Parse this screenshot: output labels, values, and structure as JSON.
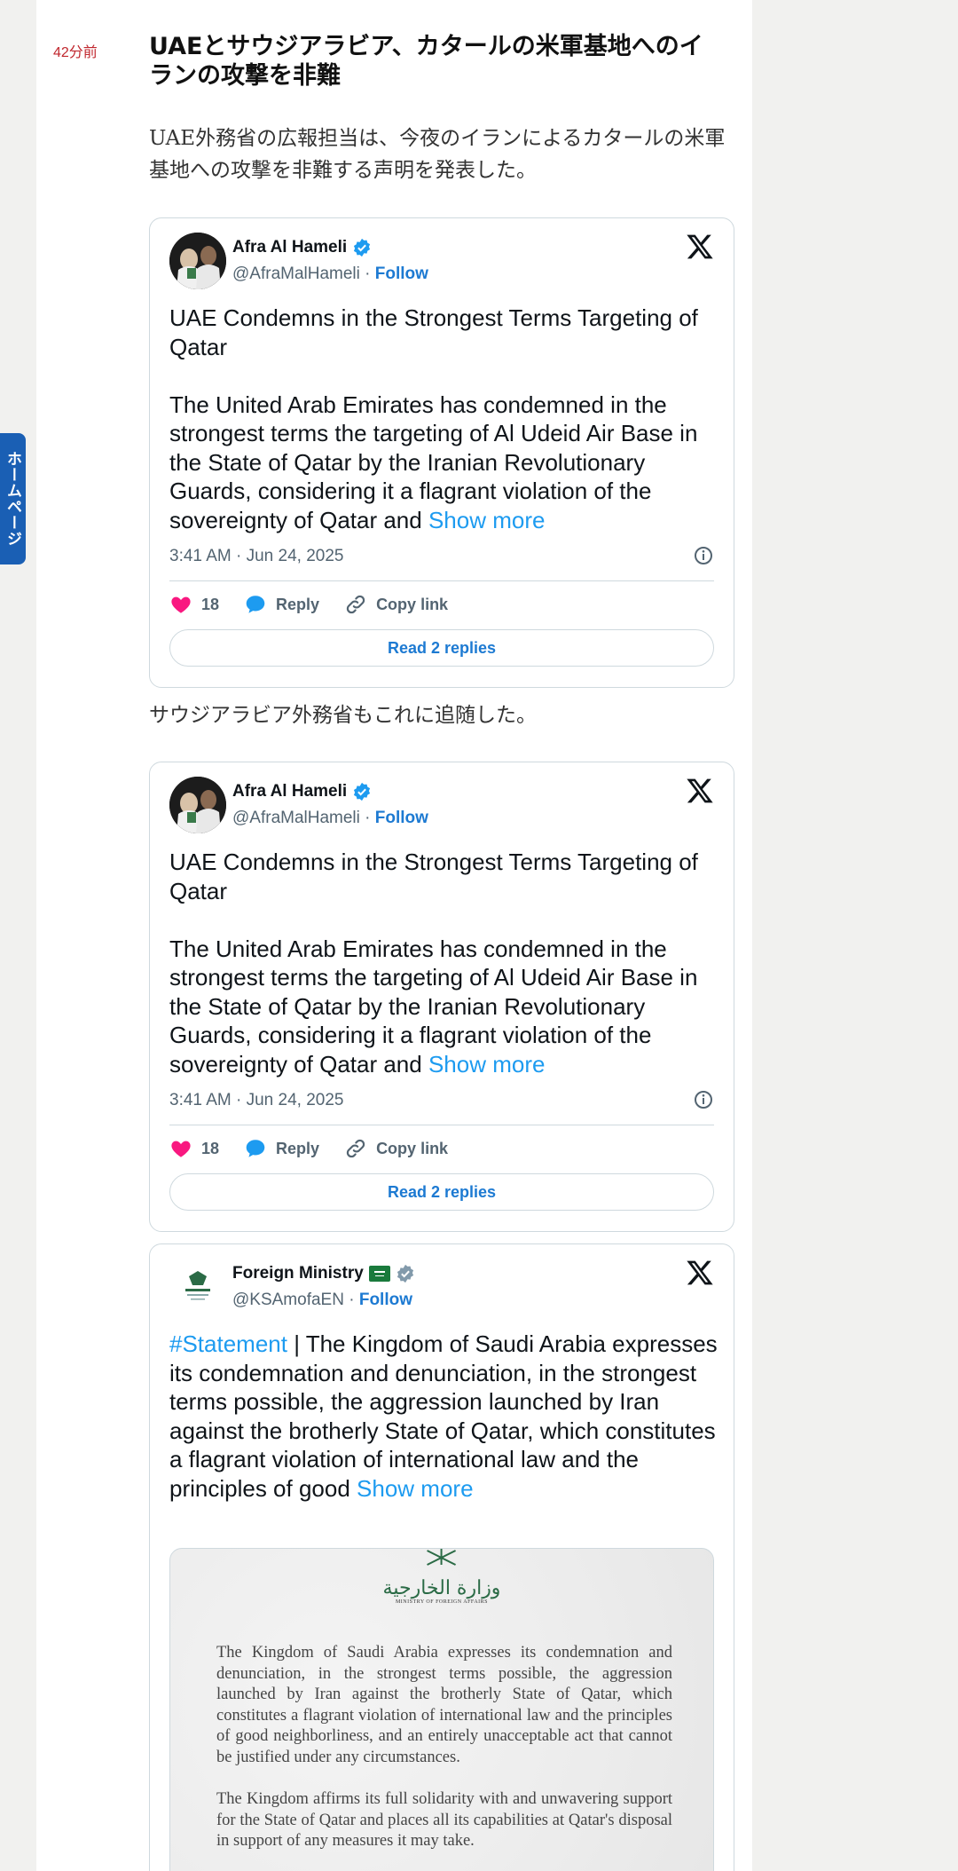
{
  "side_tab": {
    "label": "ホームページ"
  },
  "article": {
    "time_ago": "42分前",
    "headline": "UAEとサウジアラビア、カタールの米軍基地へのイランの攻撃を非難",
    "para1": "UAE外務省の広報担当は、今夜のイランによるカタールの米軍基地への攻撃を非難する声明を発表した。",
    "para2": "サウジアラビア外務省もこれに追随した。"
  },
  "tweets": [
    {
      "name": "Afra Al Hameli",
      "handle": "@AfraMalHameli",
      "follow": "Follow",
      "sep": " · ",
      "text": "UAE Condemns in the Strongest Terms Targeting of Qatar\n\nThe United Arab Emirates has condemned in the strongest terms the targeting of Al Udeid Air Base in the State of Qatar by the Iranian Revolutionary Guards, considering it a flagrant violation of the sovereignty of Qatar and",
      "show_more": "Show more",
      "date": "3:41 AM · Jun 24, 2025",
      "likes": "18",
      "reply": "Reply",
      "copy": "Copy link",
      "read_replies": "Read 2 replies"
    },
    {
      "name": "Afra Al Hameli",
      "handle": "@AfraMalHameli",
      "follow": "Follow",
      "sep": " · ",
      "text": "UAE Condemns in the Strongest Terms Targeting of Qatar\n\nThe United Arab Emirates has condemned in the strongest terms the targeting of Al Udeid Air Base in the State of Qatar by the Iranian Revolutionary Guards, considering it a flagrant violation of the sovereignty of Qatar and",
      "show_more": "Show more",
      "date": "3:41 AM · Jun 24, 2025",
      "likes": "18",
      "reply": "Reply",
      "copy": "Copy link",
      "read_replies": "Read 2 replies"
    },
    {
      "name": "Foreign Ministry",
      "handle": "@KSAmofaEN",
      "follow": "Follow",
      "sep": " · ",
      "hashtag": "#Statement",
      "text": " | The Kingdom of Saudi Arabia expresses its condemnation and denunciation, in the strongest terms possible, the aggression launched by Iran against the brotherly State of Qatar, which constitutes a flagrant violation of international law and the principles of good",
      "show_more": "Show more",
      "image": {
        "emblem_ar": "وزارة الخارجية",
        "emblem_en": "MINISTRY OF FOREIGN AFFAIRS",
        "p1": "The Kingdom of Saudi Arabia expresses its condemnation and denunciation, in the strongest terms possible, the aggression launched by Iran against the brotherly State of Qatar, which constitutes a flagrant violation of international law and the principles of good neighborliness, and an entirely unacceptable act that cannot be justified under any circumstances.",
        "p2": "The Kingdom affirms its full solidarity with and unwavering support for the State of Qatar and places all its capabilities at Qatar's disposal in support of any measures it may take."
      }
    }
  ],
  "colors": {
    "accent": "#1d9bf0",
    "link": "#1d7ad2",
    "heart": "#f91880",
    "tab": "#1a5fb4",
    "time": "#c0262d"
  }
}
